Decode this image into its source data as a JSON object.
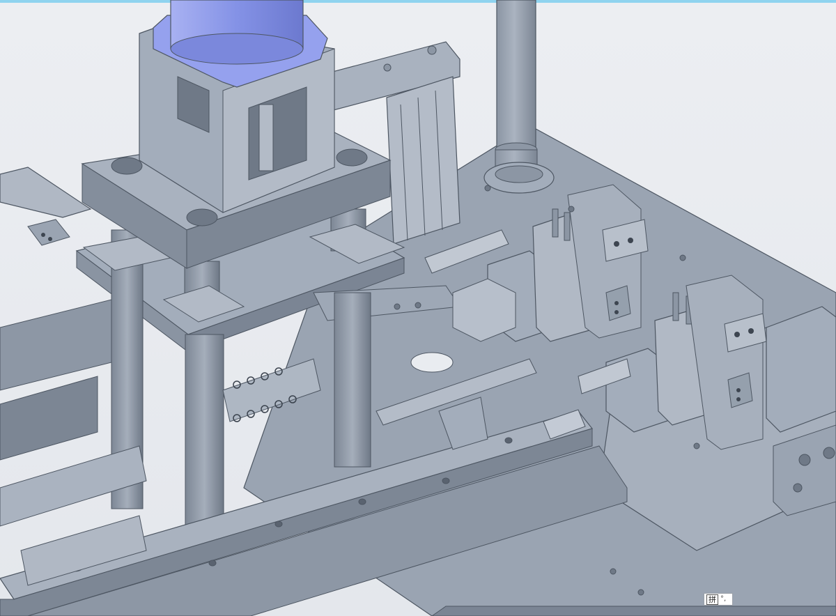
{
  "viewport": {
    "background": "#e8ebef",
    "topbar_color": "#8fd3ef",
    "part_color": "#a3adbb",
    "part_dark": "#6f7a88",
    "part_light": "#c9d0da",
    "motor_color": "#8e9ae6"
  },
  "ime_indicator": {
    "mode_label": "拼",
    "punctuation_label": "°,"
  }
}
